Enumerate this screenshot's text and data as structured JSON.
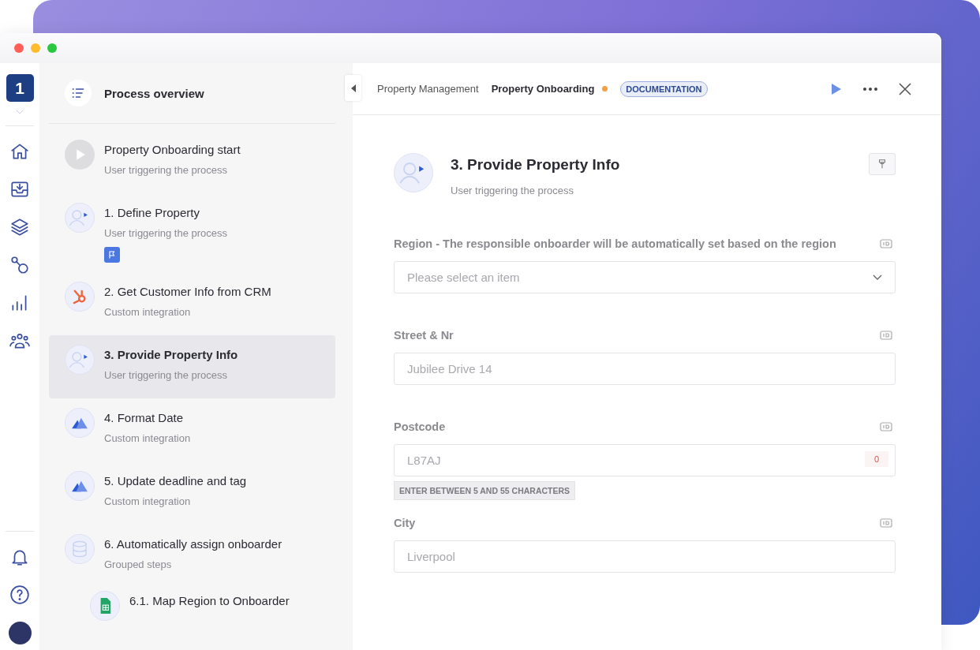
{
  "app_nav": {
    "logo": "1"
  },
  "process_panel": {
    "title": "Process overview",
    "steps": [
      {
        "kind": "trigger",
        "title": "Property Onboarding start",
        "subtitle": "User triggering the process",
        "selected": false,
        "flag": false
      },
      {
        "kind": "user",
        "title": "1. Define Property",
        "subtitle": "User triggering the process",
        "selected": false,
        "flag": true
      },
      {
        "kind": "crm",
        "title": "2. Get Customer Info from CRM",
        "subtitle": "Custom integration",
        "selected": false,
        "flag": false
      },
      {
        "kind": "user",
        "title": "3. Provide Property Info",
        "subtitle": "User triggering the process",
        "selected": true,
        "flag": false
      },
      {
        "kind": "integration",
        "title": "4. Format Date",
        "subtitle": "Custom integration",
        "selected": false,
        "flag": false
      },
      {
        "kind": "integration",
        "title": "5. Update deadline and tag",
        "subtitle": "Custom integration",
        "selected": false,
        "flag": false
      },
      {
        "kind": "group",
        "title": "6. Automatically assign onboarder",
        "subtitle": "Grouped steps",
        "selected": false,
        "flag": false,
        "children": [
          {
            "kind": "sheet",
            "title": "6.1. Map Region to Onboarder",
            "selected": false,
            "flag": false
          }
        ]
      }
    ]
  },
  "header": {
    "breadcrumbs": [
      "Property Management",
      "Property Onboarding"
    ],
    "badge": "DOCUMENTATION"
  },
  "step_detail": {
    "title": "3. Provide Property Info",
    "subtitle": "User triggering the process",
    "fields": [
      {
        "kind": "select",
        "label": "Region - The responsible onboarder will be automatically set based on the region",
        "placeholder": "Please select an item"
      },
      {
        "kind": "text",
        "label": "Street & Nr",
        "placeholder": "Jubilee Drive 14"
      },
      {
        "kind": "text",
        "label": "Postcode",
        "placeholder": "L87AJ",
        "counter": "0",
        "hint": "ENTER BETWEEN 5 AND 55 CHARACTERS"
      },
      {
        "kind": "text",
        "label": "City",
        "placeholder": "Liverpool"
      }
    ]
  }
}
